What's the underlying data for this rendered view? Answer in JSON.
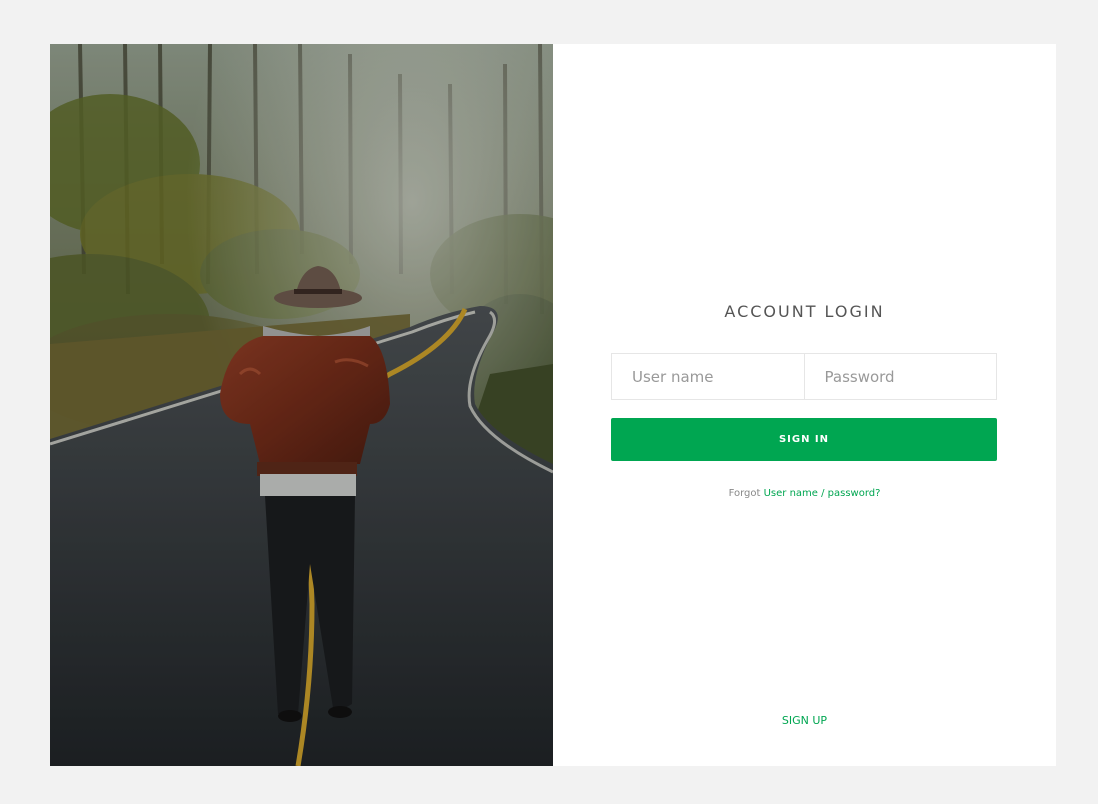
{
  "colors": {
    "accent": "#00a651",
    "page_background": "#f2f2f2",
    "card_background": "#ffffff"
  },
  "hero": {
    "image": "man-in-hat-walking-on-forest-road-photo"
  },
  "login": {
    "title": "ACCOUNT LOGIN",
    "username_placeholder": "User name",
    "password_placeholder": "Password",
    "username_value": "",
    "password_value": "",
    "signin_label": "SIGN IN",
    "forgot_prefix": "Forgot",
    "forgot_link": "User name / password?",
    "signup_label": "SIGN UP"
  }
}
